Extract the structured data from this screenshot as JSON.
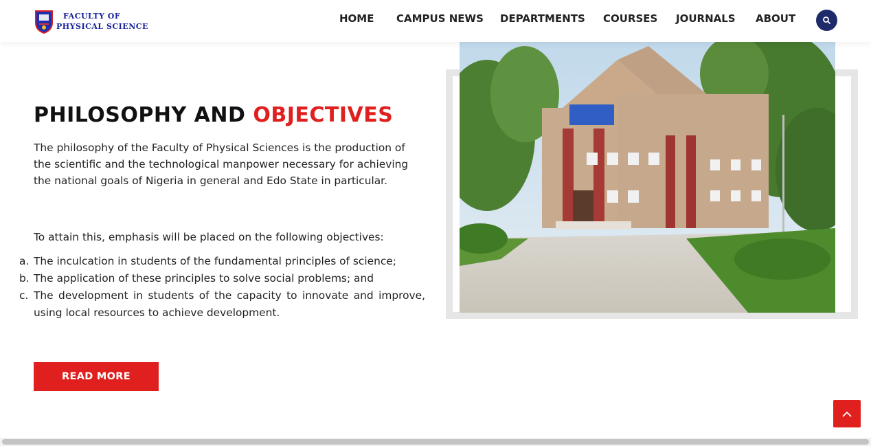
{
  "header": {
    "logo": {
      "line1": "FACULTY OF",
      "line2": "PHYSICAL SCIENCE"
    },
    "nav": [
      {
        "label": "HOME"
      },
      {
        "label": "CAMPUS NEWS"
      },
      {
        "label": "DEPARTMENTS"
      },
      {
        "label": "COURSES"
      },
      {
        "label": "JOURNALS"
      },
      {
        "label": "ABOUT"
      }
    ],
    "search_icon": "search-icon"
  },
  "section": {
    "title_part1": "PHILOSOPHY AND ",
    "title_part2": "OBJECTIVES",
    "paragraph1": "The philosophy of the Faculty of Physical Sciences is the production of the scientific and the technological manpower necessary for achieving the national goals of Nigeria in general and Edo State in particular.",
    "paragraph2": "To attain this, emphasis will be placed on the following objectives:",
    "objectives": [
      {
        "marker": "a.",
        "text": "The inculcation in students of the fundamental principles of science;"
      },
      {
        "marker": "b.",
        "text": "The application of these principles to solve social problems; and"
      },
      {
        "marker": "c.",
        "text": "The development in students of the capacity to innovate and improve, using local resources to achieve development."
      }
    ],
    "button_label": "READ MORE"
  },
  "colors": {
    "accent": "#e0201e",
    "navy": "#1f2a6b",
    "logo_text": "#17219a"
  },
  "icons": {
    "scroll_top": "chevron-up-icon"
  }
}
